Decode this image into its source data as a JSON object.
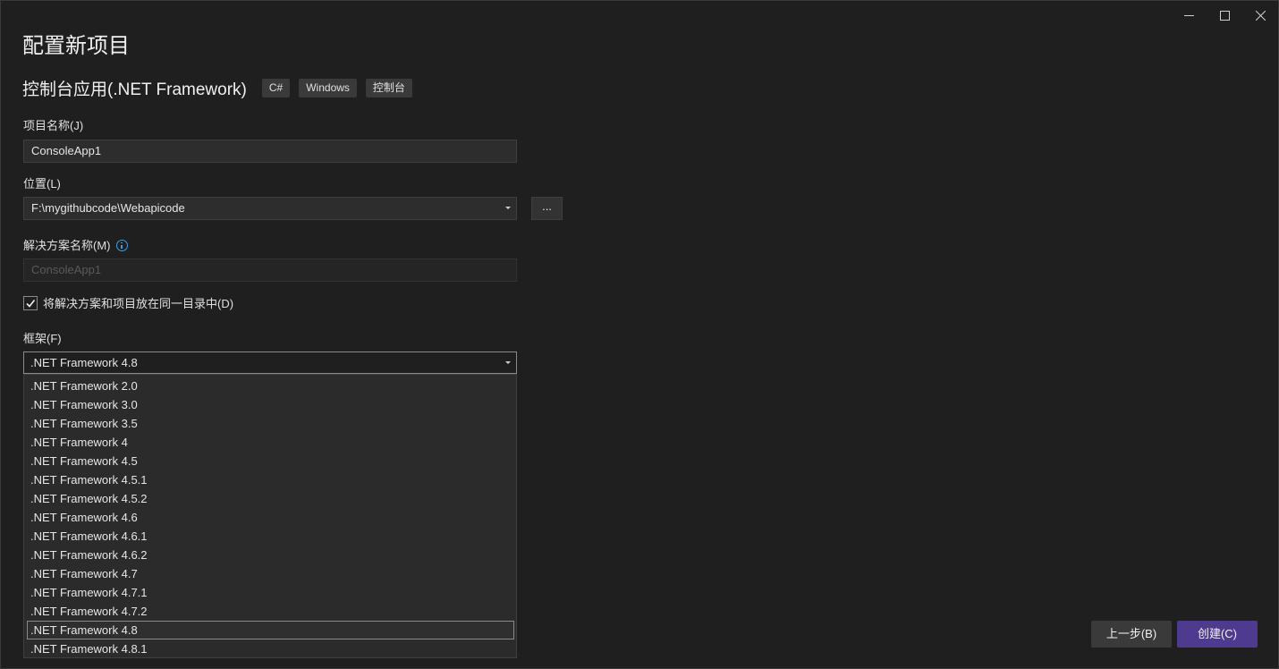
{
  "window": {
    "controls": [
      "minimize",
      "maximize",
      "close"
    ]
  },
  "page_title": "配置新项目",
  "template": {
    "name": "控制台应用(.NET Framework)",
    "tags": [
      "C#",
      "Windows",
      "控制台"
    ]
  },
  "project_name": {
    "label": "项目名称(J)",
    "value": "ConsoleApp1"
  },
  "location": {
    "label": "位置(L)",
    "value": "F:\\mygithubcode\\Webapicode",
    "browse_label": "..."
  },
  "solution_name": {
    "label": "解决方案名称(M)",
    "placeholder": "ConsoleApp1"
  },
  "same_dir": {
    "label": "将解决方案和项目放在同一目录中(D)",
    "checked": true
  },
  "framework": {
    "label": "框架(F)",
    "selected": ".NET Framework 4.8",
    "options": [
      ".NET Framework 2.0",
      ".NET Framework 3.0",
      ".NET Framework 3.5",
      ".NET Framework 4",
      ".NET Framework 4.5",
      ".NET Framework 4.5.1",
      ".NET Framework 4.5.2",
      ".NET Framework 4.6",
      ".NET Framework 4.6.1",
      ".NET Framework 4.6.2",
      ".NET Framework 4.7",
      ".NET Framework 4.7.1",
      ".NET Framework 4.7.2",
      ".NET Framework 4.8",
      ".NET Framework 4.8.1"
    ]
  },
  "buttons": {
    "back": "上一步(B)",
    "create": "创建(C)"
  },
  "colors": {
    "background": "#1f1f1f",
    "accent": "#4e3a8e",
    "info": "#3d9fe0"
  }
}
